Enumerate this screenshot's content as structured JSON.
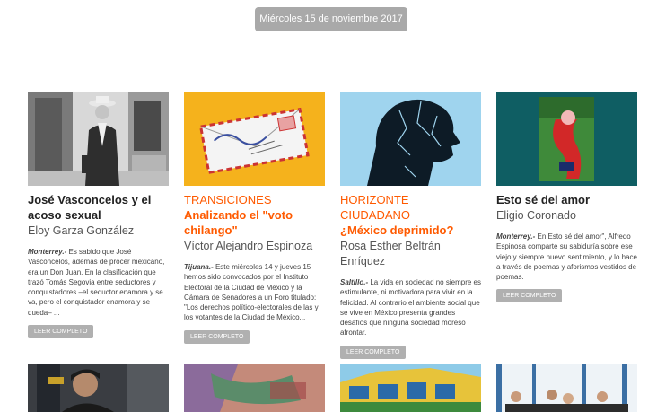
{
  "date": "Miércoles 15 de noviembre 2017",
  "cards": [
    {
      "section": "",
      "title": "José Vasconcelos y el acoso sexual",
      "author": "Eloy Garza González",
      "place": "Monterrey.-",
      "excerpt": " Es sabido que José Vasconcelos, además de prócer mexicano, era un Don Juan. En la clasificación que trazó Tomás Segovia entre seductores y conquistadores –el seductor enamora y se va, pero el conquistador enamora y se queda– ...",
      "button": "LEER COMPLETO"
    },
    {
      "section": "TRANSICIONES",
      "title": "Analizando el \"voto chilango\"",
      "author": "Víctor Alejandro Espinoza",
      "place": "Tijuana.-",
      "excerpt": " Este miércoles 14 y jueves 15 hemos sido convocados por el Instituto Electoral de la Ciudad de México y la Cámara de Senadores a un Foro titulado: \"Los derechos político-electorales de las y los votantes de la Ciudad de México...",
      "button": "LEER COMPLETO"
    },
    {
      "section": "HORIZONTE CIUDADANO",
      "title": "¿México deprimido?",
      "author": "Rosa Esther Beltrán Enríquez",
      "place": "Saltillo.-",
      "excerpt": " La vida en sociedad no siempre es estimulante, ni motivadora para vivir en la felicidad. Al contrario el ambiente social que se vive en México presenta grandes desafíos que ninguna sociedad moreso afrontar.",
      "button": "LEER COMPLETO"
    },
    {
      "section": "",
      "title": "Esto sé del amor",
      "author": "Eligio Coronado",
      "place": "Monterrey.-",
      "excerpt": " En Esto sé del amor\", Alfredo Espinosa comparte su sabiduría sobre ese viejo y siempre nuevo sentimiento, y lo hace a través de poemas y aforismos vestidos de poemas.",
      "button": "LEER COMPLETO"
    }
  ]
}
